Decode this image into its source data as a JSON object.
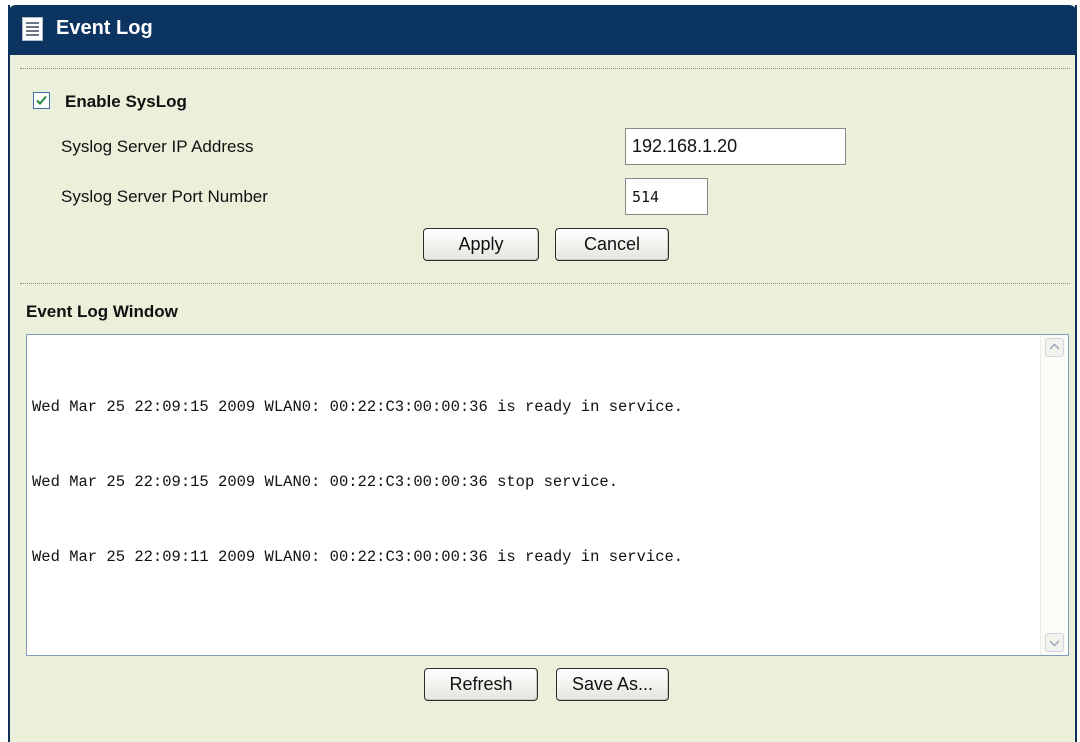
{
  "header": {
    "title": "Event Log",
    "icon": "document-list-icon"
  },
  "syslog": {
    "enable_label": "Enable SysLog",
    "enabled": true,
    "ip_label": "Syslog Server IP Address",
    "ip_value": "192.168.1.20",
    "port_label": "Syslog Server Port Number",
    "port_value": "514",
    "apply_label": "Apply",
    "cancel_label": "Cancel"
  },
  "log": {
    "section_title": "Event Log Window",
    "lines": [
      "Wed Mar 25 22:09:15 2009 WLAN0: 00:22:C3:00:00:36 is ready in service.",
      "Wed Mar 25 22:09:15 2009 WLAN0: 00:22:C3:00:00:36 stop service.",
      "Wed Mar 25 22:09:11 2009 WLAN0: 00:22:C3:00:00:36 is ready in service."
    ],
    "refresh_label": "Refresh",
    "save_label": "Save As..."
  },
  "colors": {
    "header_bg": "#0c3460",
    "panel_bg": "#eaf0da",
    "checkmark": "#1f8a3a"
  }
}
